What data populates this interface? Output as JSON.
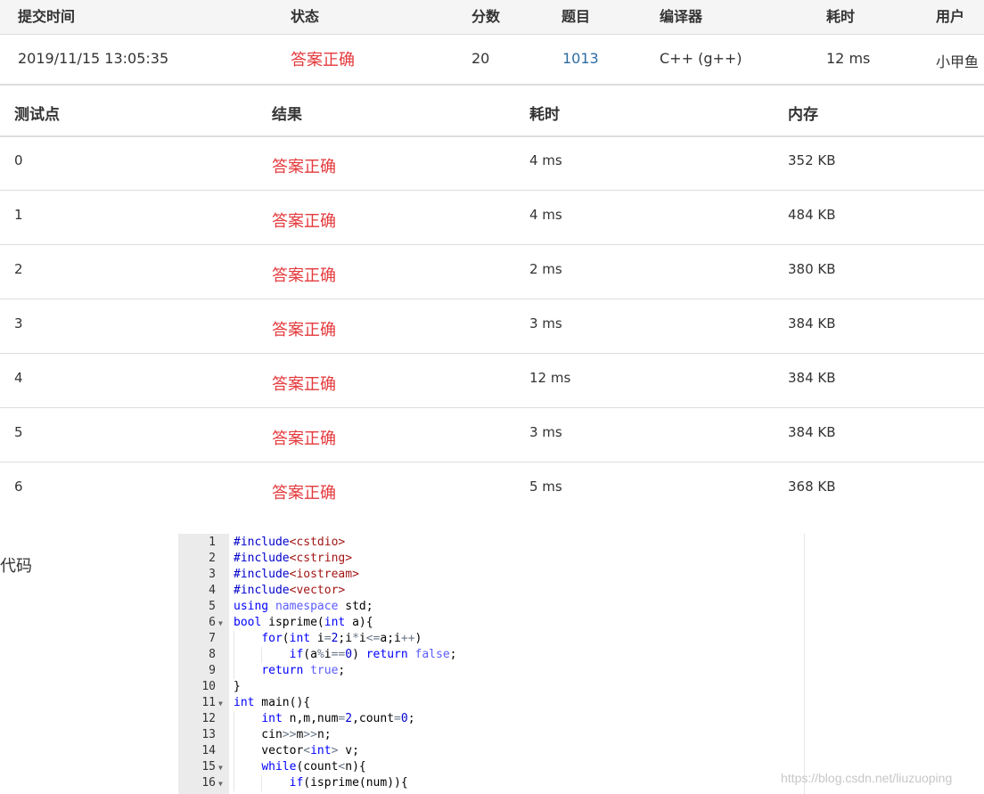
{
  "submission": {
    "headers": [
      "提交时间",
      "状态",
      "分数",
      "题目",
      "编译器",
      "耗时",
      "用户"
    ],
    "row": {
      "time": "2019/11/15 13:05:35",
      "status": "答案正确",
      "score": "20",
      "problem": "1013",
      "compiler": "C++ (g++)",
      "elapsed": "12 ms",
      "user": "小甲鱼"
    }
  },
  "cases": {
    "headers": [
      "测试点",
      "结果",
      "耗时",
      "内存"
    ],
    "rows": [
      {
        "id": "0",
        "result": "答案正确",
        "time": "4 ms",
        "memory": "352 KB"
      },
      {
        "id": "1",
        "result": "答案正确",
        "time": "4 ms",
        "memory": "484 KB"
      },
      {
        "id": "2",
        "result": "答案正确",
        "time": "2 ms",
        "memory": "380 KB"
      },
      {
        "id": "3",
        "result": "答案正确",
        "time": "3 ms",
        "memory": "384 KB"
      },
      {
        "id": "4",
        "result": "答案正确",
        "time": "12 ms",
        "memory": "384 KB"
      },
      {
        "id": "5",
        "result": "答案正确",
        "time": "3 ms",
        "memory": "384 KB"
      },
      {
        "id": "6",
        "result": "答案正确",
        "time": "5 ms",
        "memory": "368 KB"
      }
    ]
  },
  "code": {
    "label": "代码",
    "lines": [
      {
        "no": "1",
        "fold": false,
        "text": "#include<cstdio>"
      },
      {
        "no": "2",
        "fold": false,
        "text": "#include<cstring>"
      },
      {
        "no": "3",
        "fold": false,
        "text": "#include<iostream>"
      },
      {
        "no": "4",
        "fold": false,
        "text": "#include<vector>"
      },
      {
        "no": "5",
        "fold": false,
        "text": "using namespace std;"
      },
      {
        "no": "6",
        "fold": true,
        "text": "bool isprime(int a){"
      },
      {
        "no": "7",
        "fold": false,
        "text": "    for(int i=2;i*i<=a;i++)"
      },
      {
        "no": "8",
        "fold": false,
        "text": "        if(a%i==0) return false;"
      },
      {
        "no": "9",
        "fold": false,
        "text": "    return true;"
      },
      {
        "no": "10",
        "fold": false,
        "text": "}"
      },
      {
        "no": "11",
        "fold": true,
        "text": "int main(){"
      },
      {
        "no": "12",
        "fold": false,
        "text": "    int n,m,num=2,count=0;"
      },
      {
        "no": "13",
        "fold": false,
        "text": "    cin>>m>>n;"
      },
      {
        "no": "14",
        "fold": false,
        "text": "    vector<int> v;"
      },
      {
        "no": "15",
        "fold": true,
        "text": "    while(count<n){"
      },
      {
        "no": "16",
        "fold": true,
        "text": "        if(isprime(num)){"
      }
    ]
  },
  "watermark": "https://blog.csdn.net/liuzuoping",
  "colors": {
    "accepted": "#e4393c",
    "link": "#2d6ca2",
    "keyword": "#0000ff",
    "string": "#a31515"
  }
}
